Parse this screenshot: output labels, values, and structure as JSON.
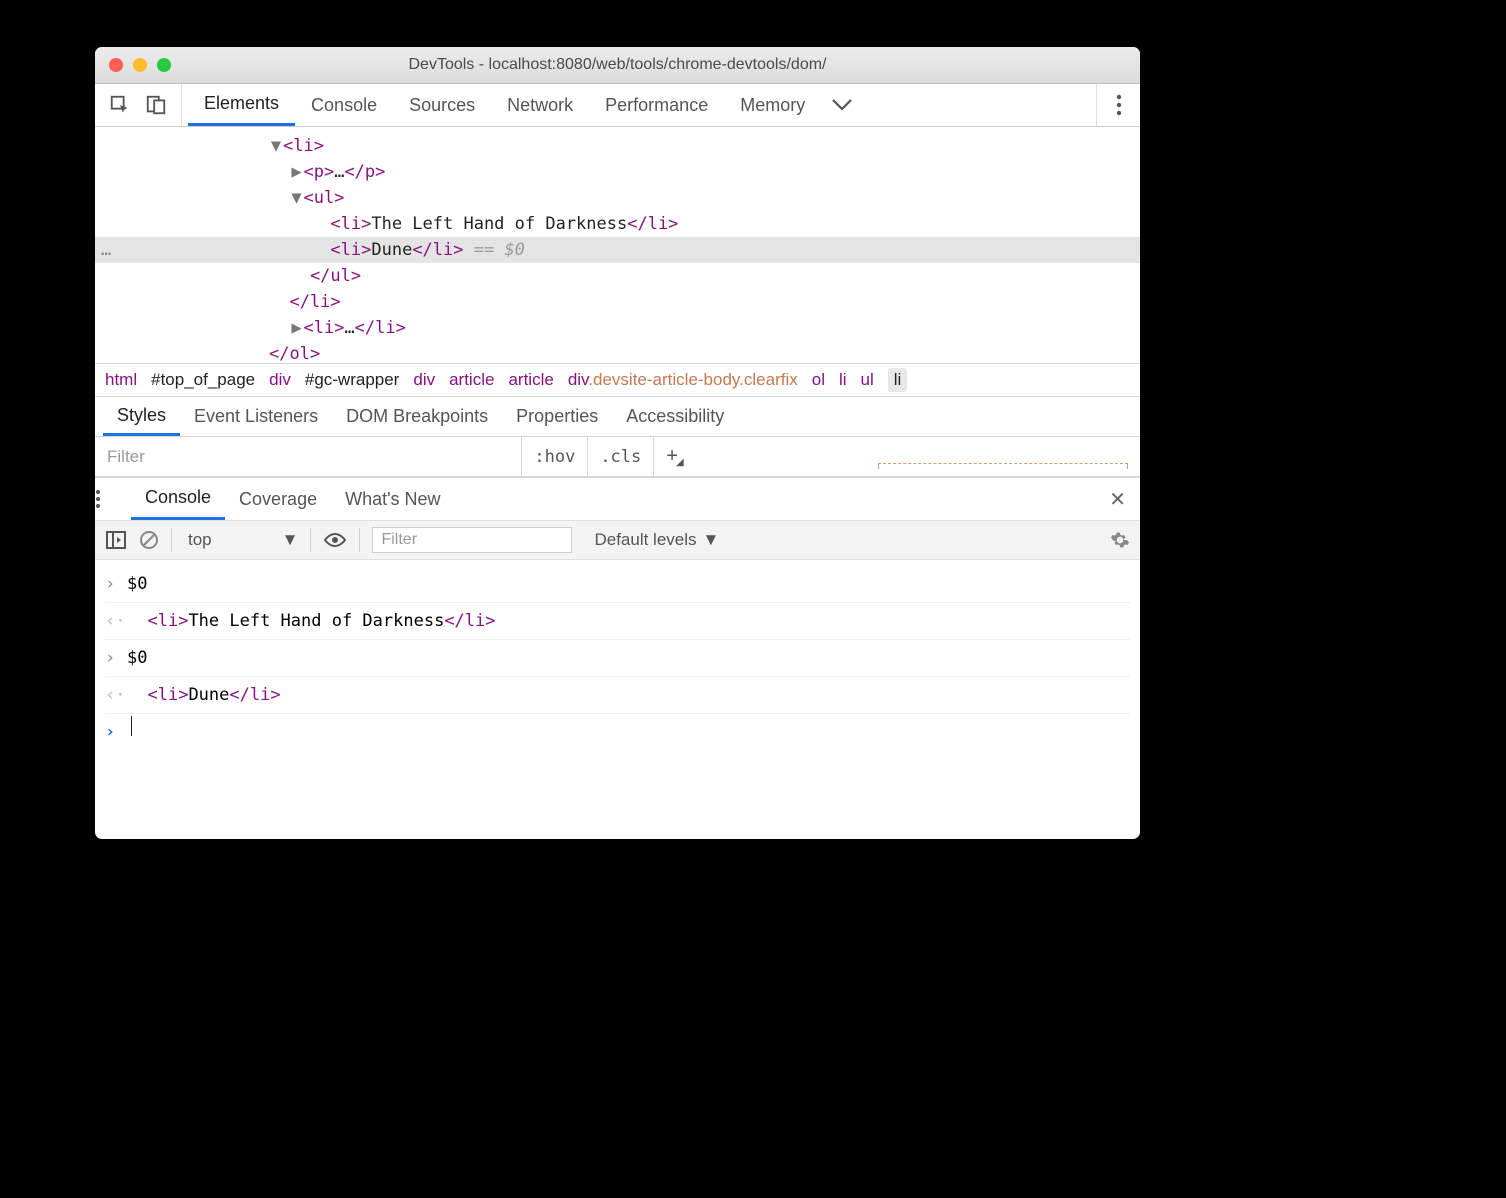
{
  "window": {
    "title": "DevTools - localhost:8080/web/tools/chrome-devtools/dom/"
  },
  "tabs": [
    "Elements",
    "Console",
    "Sources",
    "Network",
    "Performance",
    "Memory"
  ],
  "active_tab": "Elements",
  "dom": {
    "line1_tag_open": "<li>",
    "line2_p": "<p>",
    "line2_ellipsis": "…",
    "line2_p_close": "</p>",
    "line3_ul": "<ul>",
    "line4_li_open": "<li>",
    "line4_text": "The Left Hand of Darkness",
    "line4_li_close": "</li>",
    "line5_li_open": "<li>",
    "line5_text": "Dune",
    "line5_li_close": "</li>",
    "line5_suffix": " == $0",
    "line6_ul_close": "</ul>",
    "line7_li_close": "</li>",
    "line8_li_open": "<li>",
    "line8_ellipsis": "…",
    "line8_li_close": "</li>",
    "line9_ol_close": "</ol>"
  },
  "crumbs": [
    "html",
    "#top_of_page",
    "div",
    "#gc-wrapper",
    "div",
    "article",
    "article",
    "div.devsite-article-body.clearfix",
    "ol",
    "li",
    "ul",
    "li"
  ],
  "subtabs": [
    "Styles",
    "Event Listeners",
    "DOM Breakpoints",
    "Properties",
    "Accessibility"
  ],
  "active_subtab": "Styles",
  "styles": {
    "filter_placeholder": "Filter",
    "hov": ":hov",
    "cls": ".cls"
  },
  "drawer_tabs": [
    "Console",
    "Coverage",
    "What's New"
  ],
  "active_drawer_tab": "Console",
  "console_ctl": {
    "context": "top",
    "filter_placeholder": "Filter",
    "levels": "Default levels"
  },
  "console_rows": [
    {
      "kind": "in",
      "text": "$0"
    },
    {
      "kind": "out",
      "html_open": "<li>",
      "text": "The Left Hand of Darkness",
      "html_close": "</li>"
    },
    {
      "kind": "in",
      "text": "$0"
    },
    {
      "kind": "out",
      "html_open": "<li>",
      "text": "Dune",
      "html_close": "</li>"
    }
  ]
}
